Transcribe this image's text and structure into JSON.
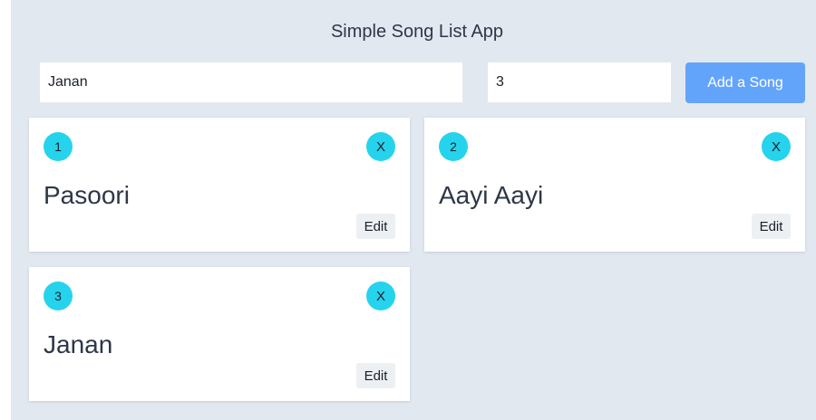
{
  "app": {
    "title": "Simple Song List App",
    "background_color": "#e2e8f0",
    "accent_color": "#26d3ec",
    "button_color": "#63a4fb"
  },
  "form": {
    "song_name_value": "Janan",
    "song_number_value": "3",
    "add_button_label": "Add a Song"
  },
  "songs": [
    {
      "number": "1",
      "name": "Pasoori",
      "delete_label": "X",
      "edit_label": "Edit"
    },
    {
      "number": "2",
      "name": "Aayi Aayi",
      "delete_label": "X",
      "edit_label": "Edit"
    },
    {
      "number": "3",
      "name": "Janan",
      "delete_label": "X",
      "edit_label": "Edit"
    }
  ]
}
